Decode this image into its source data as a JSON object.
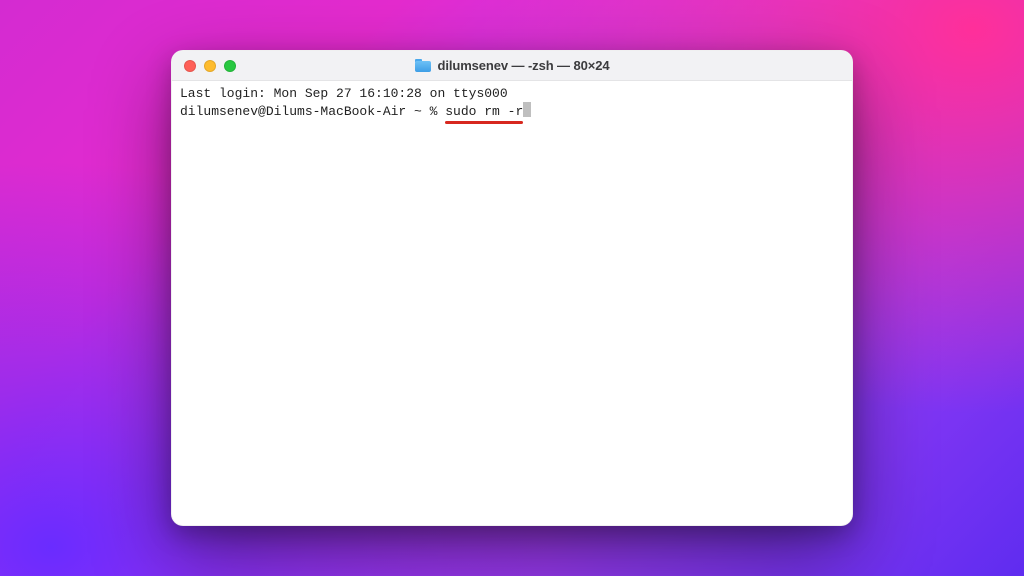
{
  "window": {
    "title": "dilumsenev — -zsh — 80×24",
    "title_icon": "home-folder-icon"
  },
  "terminal": {
    "last_login": "Last login: Mon Sep 27 16:10:28 on ttys000",
    "prompt": "dilumsenev@Dilums-MacBook-Air ~ % ",
    "command": "sudo rm -r"
  },
  "colors": {
    "annotation_underline": "#d7281f",
    "traffic_close": "#ff5f57",
    "traffic_min": "#febc2e",
    "traffic_zoom": "#28c840"
  }
}
